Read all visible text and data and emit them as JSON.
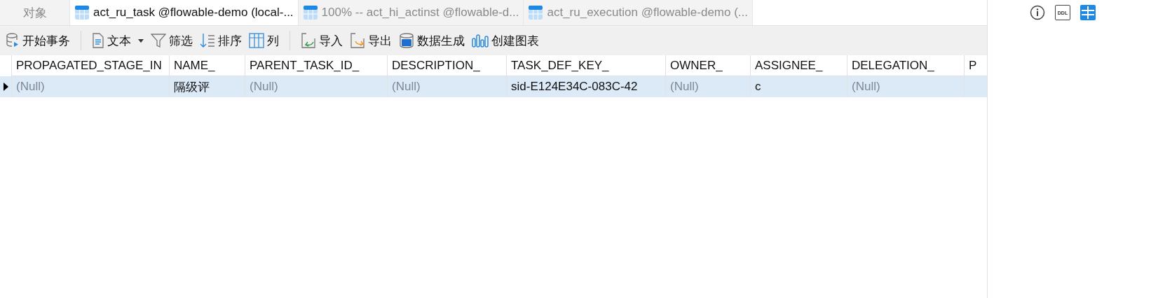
{
  "tabs": [
    {
      "label": "对象",
      "icon": false,
      "selected": false
    },
    {
      "label": "act_ru_task @flowable-demo (local-...",
      "icon": true,
      "selected": true
    },
    {
      "label": "100% -- act_hi_actinst @flowable-d...",
      "icon": true,
      "selected": false
    },
    {
      "label": "act_ru_execution @flowable-demo (...",
      "icon": true,
      "selected": false
    }
  ],
  "toolbar": [
    {
      "kind": "database",
      "label": "开始事务"
    },
    {
      "kind": "divider"
    },
    {
      "kind": "text",
      "label": "文本",
      "dropdown": true
    },
    {
      "kind": "filter",
      "label": "筛选"
    },
    {
      "kind": "sort",
      "label": "排序"
    },
    {
      "kind": "columns",
      "label": "列"
    },
    {
      "kind": "divider"
    },
    {
      "kind": "import",
      "label": "导入"
    },
    {
      "kind": "export",
      "label": "导出"
    },
    {
      "kind": "generate",
      "label": "数据生成"
    },
    {
      "kind": "chart",
      "label": "创建图表"
    }
  ],
  "side_icons": [
    {
      "kind": "info",
      "selected": false
    },
    {
      "kind": "ddl",
      "text": "DDL",
      "selected": false
    },
    {
      "kind": "grid",
      "selected": true
    }
  ],
  "table": {
    "columns": [
      "PROPAGATED_STAGE_IN",
      "NAME_",
      "PARENT_TASK_ID_",
      "DESCRIPTION_",
      "TASK_DEF_KEY_",
      "OWNER_",
      "ASSIGNEE_",
      "DELEGATION_",
      "P"
    ],
    "rows": [
      {
        "selected": true,
        "cells": [
          {
            "text": "(Null)",
            "null": true
          },
          {
            "text": "隔级评",
            "null": false
          },
          {
            "text": "(Null)",
            "null": true
          },
          {
            "text": "(Null)",
            "null": true
          },
          {
            "text": "sid-E124E34C-083C-42",
            "null": false
          },
          {
            "text": "(Null)",
            "null": true
          },
          {
            "text": "c",
            "null": false
          },
          {
            "text": "(Null)",
            "null": true
          }
        ]
      }
    ]
  }
}
